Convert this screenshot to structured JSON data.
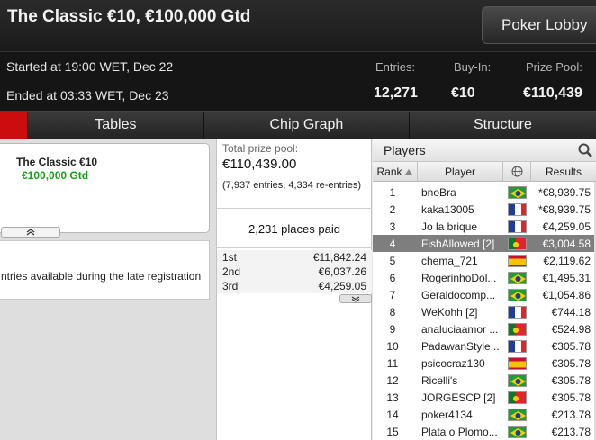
{
  "header": {
    "title": "The Classic €10, €100,000 Gtd",
    "lobby_button": "Poker Lobby"
  },
  "info": {
    "started": "Started at 19:00 WET, Dec 22",
    "ended": "Ended at 03:33 WET, Dec 23",
    "entries_label": "Entries:",
    "entries_value": "12,271",
    "buyin_label": "Buy-In:",
    "buyin_value": "€10",
    "prize_label": "Prize Pool:",
    "prize_value": "€110,439"
  },
  "tabs": [
    "Tables",
    "Chip Graph",
    "Structure"
  ],
  "card": {
    "title": "The Classic €10",
    "subtitle": "€100,000 Gtd",
    "expand_icon": "double-chevron-up-icon"
  },
  "note": "ntries available during the late registration",
  "prize_pool": {
    "label": "Total prize pool:",
    "value": "€110,439.00",
    "entries_note": "(7,937 entries, 4,334 re-entries)",
    "places_paid": "2,231 places paid",
    "payouts": [
      {
        "place": "1st",
        "amount": "€11,842.24"
      },
      {
        "place": "2nd",
        "amount": "€6,037.26"
      },
      {
        "place": "3rd",
        "amount": "€4,259.05"
      }
    ]
  },
  "players": {
    "title": "Players",
    "columns": {
      "rank": "Rank",
      "player": "Player",
      "results": "Results"
    },
    "rows": [
      {
        "rank": "1",
        "name": "bnoBra",
        "flag": "brazil",
        "result": "*€8,939.75"
      },
      {
        "rank": "2",
        "name": "kaka13005",
        "flag": "france",
        "result": "*€8,939.75"
      },
      {
        "rank": "3",
        "name": "Jo la brique",
        "flag": "france",
        "result": "€4,259.05"
      },
      {
        "rank": "4",
        "name": "FishAllowed [2]",
        "flag": "portugal",
        "result": "€3,004.58",
        "selected": true
      },
      {
        "rank": "5",
        "name": "chema_721",
        "flag": "spain",
        "result": "€2,119.62"
      },
      {
        "rank": "6",
        "name": "RogerinhoDol...",
        "flag": "brazil",
        "result": "€1,495.31"
      },
      {
        "rank": "7",
        "name": "Geraldocomp...",
        "flag": "brazil",
        "result": "€1,054.86"
      },
      {
        "rank": "8",
        "name": "WeKohh [2]",
        "flag": "france",
        "result": "€744.18"
      },
      {
        "rank": "9",
        "name": "analuciaamor ...",
        "flag": "portugal",
        "result": "€524.98"
      },
      {
        "rank": "10",
        "name": "PadawanStyle...",
        "flag": "france",
        "result": "€305.78"
      },
      {
        "rank": "11",
        "name": "psicocraz130",
        "flag": "spain",
        "result": "€305.78"
      },
      {
        "rank": "12",
        "name": "Ricelli's",
        "flag": "brazil",
        "result": "€305.78"
      },
      {
        "rank": "13",
        "name": "JORGESCP [2]",
        "flag": "portugal",
        "result": "€305.78"
      },
      {
        "rank": "14",
        "name": "poker4134",
        "flag": "brazil",
        "result": "€213.78"
      },
      {
        "rank": "15",
        "name": "Plata o Plomo...",
        "flag": "brazil",
        "result": "€213.78"
      }
    ]
  },
  "colors": {
    "accent_red": "#cc0d0d",
    "green_text": "#16a016",
    "selected_row": "#7e7e7e"
  }
}
